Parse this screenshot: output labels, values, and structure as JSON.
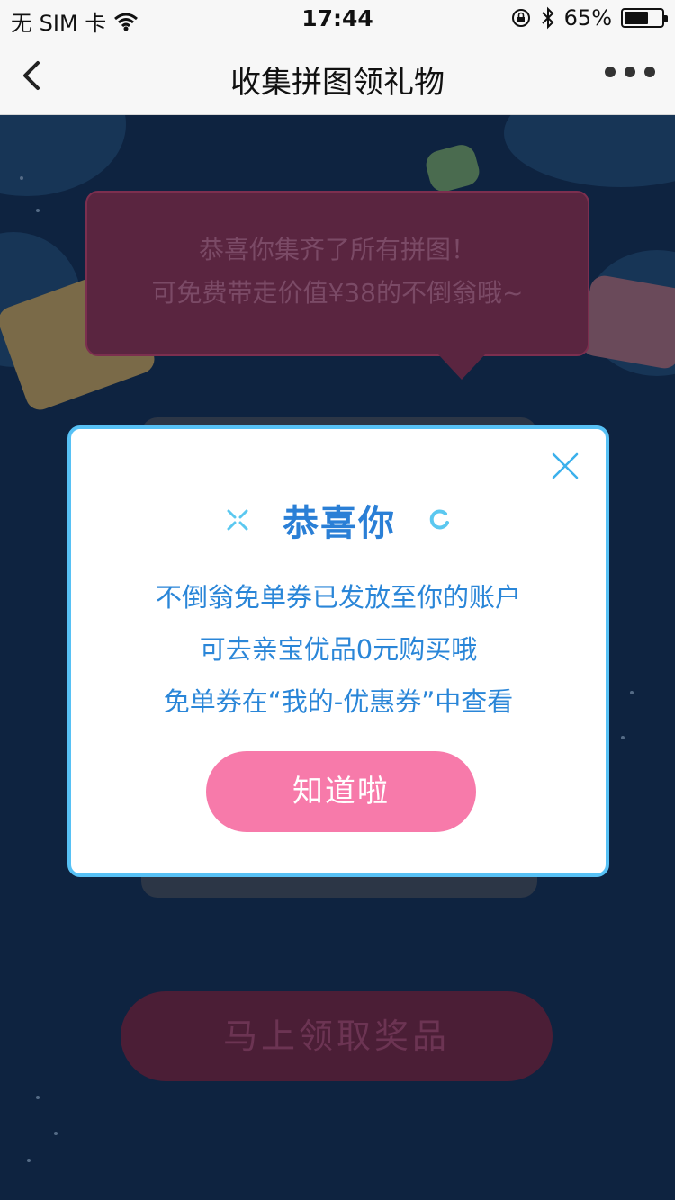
{
  "status_bar": {
    "carrier": "无 SIM 卡",
    "time": "17:44",
    "battery_percent": "65%",
    "battery_level": 0.65,
    "icons": [
      "wifi-icon",
      "rotation-lock-icon",
      "bluetooth-icon",
      "battery-icon"
    ]
  },
  "nav": {
    "title": "收集拼图领礼物",
    "icons": [
      "back-chevron-icon",
      "more-dots-icon"
    ]
  },
  "background": {
    "bubble_line1": "恭喜你集齐了所有拼图！",
    "bubble_line2": "可免费带走价值¥38的不倒翁哦~",
    "claim_button": "马上领取奖品"
  },
  "modal": {
    "title": "恭喜你",
    "line1": "不倒翁免单券已发放至你的账户",
    "line2": "可去亲宝优品0元购买哦",
    "line3": "免单券在“我的-优惠券”中查看",
    "ok_button": "知道啦",
    "icons": [
      "close-icon",
      "sparkle-icon",
      "ring-icon"
    ]
  },
  "colors": {
    "modal_border": "#57c1f5",
    "title_blue": "#2a7fd6",
    "button_pink": "#f77aaa",
    "background_navy": "#0e2340"
  }
}
